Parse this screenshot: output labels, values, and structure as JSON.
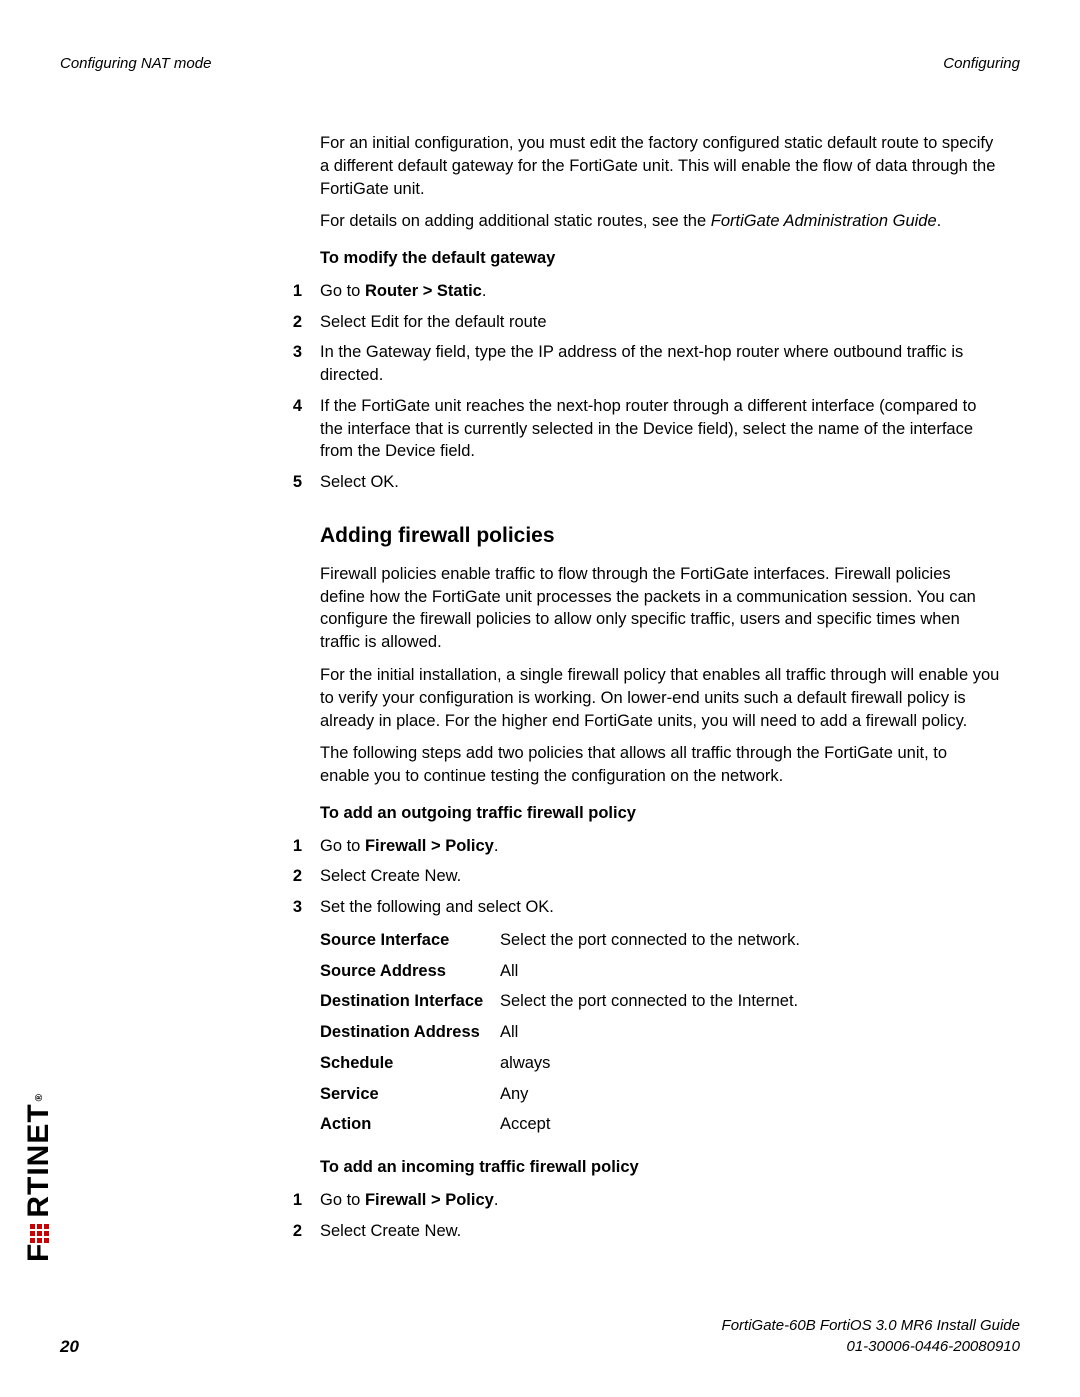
{
  "header": {
    "left": "Configuring NAT mode",
    "right": "Configuring"
  },
  "intro1_a": "For an initial configuration, you must edit the factory configured static default route to specify a different default gateway for the FortiGate unit. This will enable the flow of data through the FortiGate unit.",
  "intro2_prefix": "For details on adding additional static routes, see the ",
  "intro2_italic": "FortiGate Administration Guide",
  "intro2_suffix": ".",
  "subhead_modify": "To modify the default gateway",
  "steps_modify": [
    {
      "num": "1",
      "prefix": "Go to ",
      "bold": "Router > Static",
      "suffix": "."
    },
    {
      "num": "2",
      "text": "Select Edit for the default route"
    },
    {
      "num": "3",
      "text": "In the Gateway field, type the IP address of the next-hop router where outbound traffic is directed."
    },
    {
      "num": "4",
      "text": "If the FortiGate unit reaches the next-hop router through a different interface (compared to the interface that is currently selected in the Device field), select the name of the interface from the Device field."
    },
    {
      "num": "5",
      "text": "Select OK."
    }
  ],
  "section_firewall": "Adding firewall policies",
  "fw_p1": "Firewall policies enable traffic to flow through the FortiGate interfaces. Firewall policies define how the FortiGate unit processes the packets in a communication session. You can configure the firewall policies to allow only specific traffic, users and specific times when traffic is allowed.",
  "fw_p2": "For the initial installation, a single firewall policy that enables all traffic through will enable you to verify your configuration is working. On lower-end units such a default firewall policy is already in place. For the higher end FortiGate units, you will need to add a firewall policy.",
  "fw_p3": "The following steps add two policies that allows all traffic through the FortiGate unit, to enable you to continue testing the configuration on the network.",
  "subhead_outgoing": "To add an outgoing traffic firewall policy",
  "steps_outgoing": [
    {
      "num": "1",
      "prefix": "Go to ",
      "bold": "Firewall > Policy",
      "suffix": "."
    },
    {
      "num": "2",
      "text": "Select Create New."
    },
    {
      "num": "3",
      "text": "Set the following and select OK."
    }
  ],
  "params": [
    {
      "name": "Source Interface",
      "val": "Select the port connected to the network."
    },
    {
      "name": "Source Address",
      "val": "All"
    },
    {
      "name": "Destination Interface",
      "val": "Select the port connected to the Internet."
    },
    {
      "name": "Destination Address",
      "val": "All"
    },
    {
      "name": "Schedule",
      "val": "always"
    },
    {
      "name": "Service",
      "val": "Any"
    },
    {
      "name": "Action",
      "val": "Accept"
    }
  ],
  "subhead_incoming": "To add an incoming traffic firewall policy",
  "steps_incoming": [
    {
      "num": "1",
      "prefix": "Go to ",
      "bold": "Firewall > Policy",
      "suffix": "."
    },
    {
      "num": "2",
      "text": "Select Create New."
    }
  ],
  "footer": {
    "line1": "FortiGate-60B FortiOS 3.0 MR6 Install Guide",
    "line2": "01-30006-0446-20080910",
    "page": "20"
  },
  "logo": {
    "text": "F",
    "rest": "RTINET",
    "reg": "®"
  }
}
